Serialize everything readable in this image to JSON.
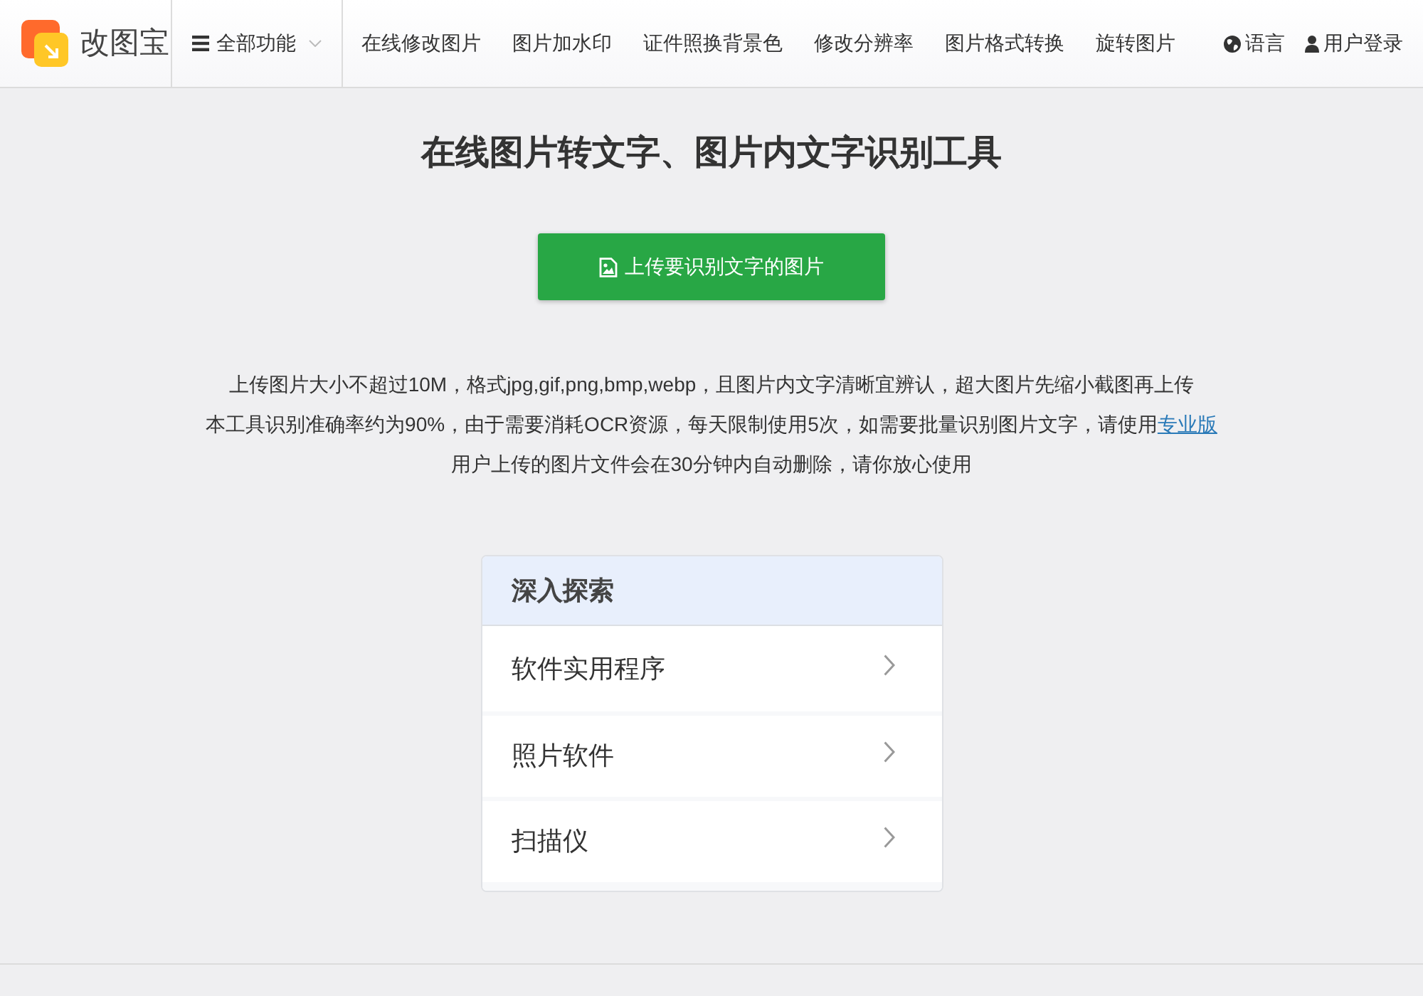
{
  "header": {
    "logo_text": "改图宝",
    "menu": {
      "label": "全部功能"
    },
    "nav": [
      "在线修改图片",
      "图片加水印",
      "证件照换背景色",
      "修改分辨率",
      "图片格式转换",
      "旋转图片"
    ],
    "language": "语言",
    "login": "用户登录"
  },
  "title": "在线图片转文字、图片内文字识别工具",
  "upload_button": "上传要识别文字的图片",
  "notes": [
    {
      "text": "上传图片大小不超过10M，格式jpg,gif,png,bmp,webp，且图片内文字清晰宜辨认，超大图片先缩小截图再上传"
    },
    {
      "text": "本工具识别准确率约为90%，由于需要消耗OCR资源，每天限制使用5次，如需要批量识别图片文字，请使用",
      "link": "专业版"
    },
    {
      "text": "用户上传的图片文件会在30分钟内自动删除，请你放心使用"
    }
  ],
  "explore": {
    "title": "深入探索",
    "items": [
      "软件实用程序",
      "照片软件",
      "扫描仪"
    ]
  }
}
